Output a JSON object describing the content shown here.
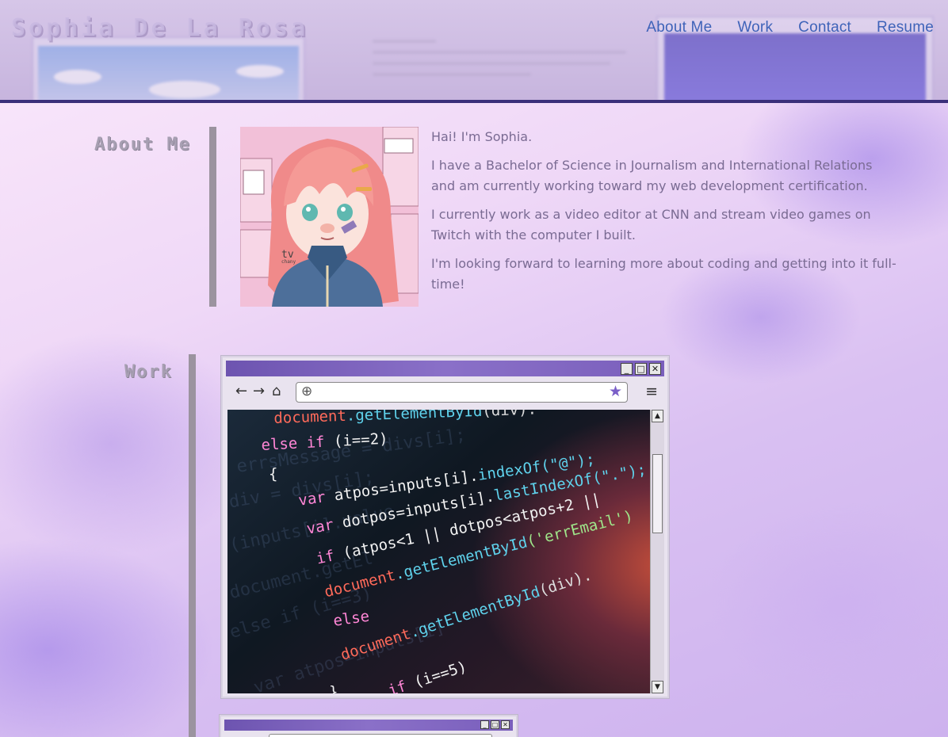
{
  "header": {
    "name": "Sophia De La Rosa",
    "nav": [
      {
        "label": "About Me"
      },
      {
        "label": "Work"
      },
      {
        "label": "Contact"
      },
      {
        "label": "Resume"
      }
    ]
  },
  "about": {
    "heading": "About Me",
    "paragraphs": [
      "Hai! I'm Sophia.",
      "I have a Bachelor of Science in Journalism and International Relations and am currently working toward my web development certification.",
      "I currently work as a video editor at CNN and stream video games on Twitch with the computer I built.",
      "I'm looking forward to learning more about coding and getting into it full-time!"
    ],
    "avatar_signature": "tv chany"
  },
  "work": {
    "heading": "Work",
    "code_lines": [
      {
        "a": "document",
        "b": ".getElementById",
        "c": "(div)."
      },
      {
        "a": "else if ",
        "b": "(i==2)",
        "c": ""
      },
      {
        "a": "{",
        "b": "",
        "c": ""
      },
      {
        "a": "var ",
        "b": "atpos=inputs[i].",
        "c": "indexOf(\"@\");"
      },
      {
        "a": "var ",
        "b": "dotpos=inputs[i].",
        "c": "lastIndexOf(\".\");"
      },
      {
        "a": "if ",
        "b": "(atpos<1 || dotpos<atpos+2 ||",
        "c": ""
      },
      {
        "a": "document",
        "b": ".getElementById",
        "c": "('errEmail')"
      },
      {
        "a": "else",
        "b": "",
        "c": ""
      },
      {
        "a": "document",
        "b": ".getElementById",
        "c": "(div)."
      },
      {
        "a": "}",
        "b": "",
        "c": ""
      },
      {
        "a": "if ",
        "b": "(i==5)",
        "c": ""
      }
    ]
  },
  "colors": {
    "header_border": "#3a2f7a",
    "nav_link": "#3f63b9",
    "accent_purple": "#7a5fc8",
    "heading_gray": "#a79fb2"
  }
}
